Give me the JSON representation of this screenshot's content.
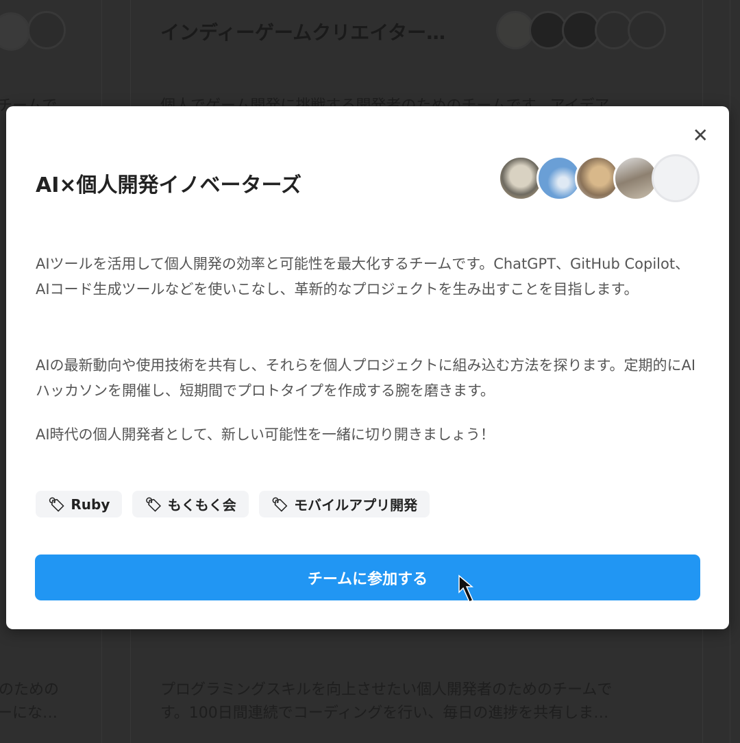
{
  "background": {
    "card_title": "インディーゲームクリエイター…",
    "card_desc_1": "個人でゲーム開発に挑戦する開発者のためのチームです。アイデア",
    "left_frag_1": "チームで",
    "left_frag_2": "のための",
    "left_frag_3": "ーにな…",
    "bottom_desc_1": "プログラミングスキルを向上させたい個人開発者のためのチームで",
    "bottom_desc_2": "す。100日間連続でコーディングを行い、毎日の進捗を共有しま…"
  },
  "modal": {
    "title": "AI×個人開発イノベーターズ",
    "close_icon": "close-icon",
    "members": [
      {
        "name": "tortoise",
        "color": "#b9a88a"
      },
      {
        "name": "sky",
        "color": "#6a9fd6"
      },
      {
        "name": "puppy",
        "color": "#b89a76"
      },
      {
        "name": "rocks",
        "color": "#9a8f82"
      },
      {
        "name": "empty",
        "color": "#f1f2f4"
      }
    ],
    "description": [
      "AIツールを活用して個人開発の効率と可能性を最大化するチームです。ChatGPT、GitHub Copilot、AIコード生成ツールなどを使いこなし、革新的なプロジェクトを生み出すことを目指します。",
      "AIの最新動向や使用技術を共有し、それらを個人プロジェクトに組み込む方法を探ります。定期的にAIハッカソンを開催し、短期間でプロトタイプを作成する腕を磨きます。",
      "AI時代の個人開発者として、新しい可能性を一緒に切り開きましょう！"
    ],
    "tags": [
      "Ruby",
      "もくもく会",
      "モバイルアプリ開発"
    ],
    "join_label": "チームに参加する",
    "accent": "#2196f3"
  }
}
